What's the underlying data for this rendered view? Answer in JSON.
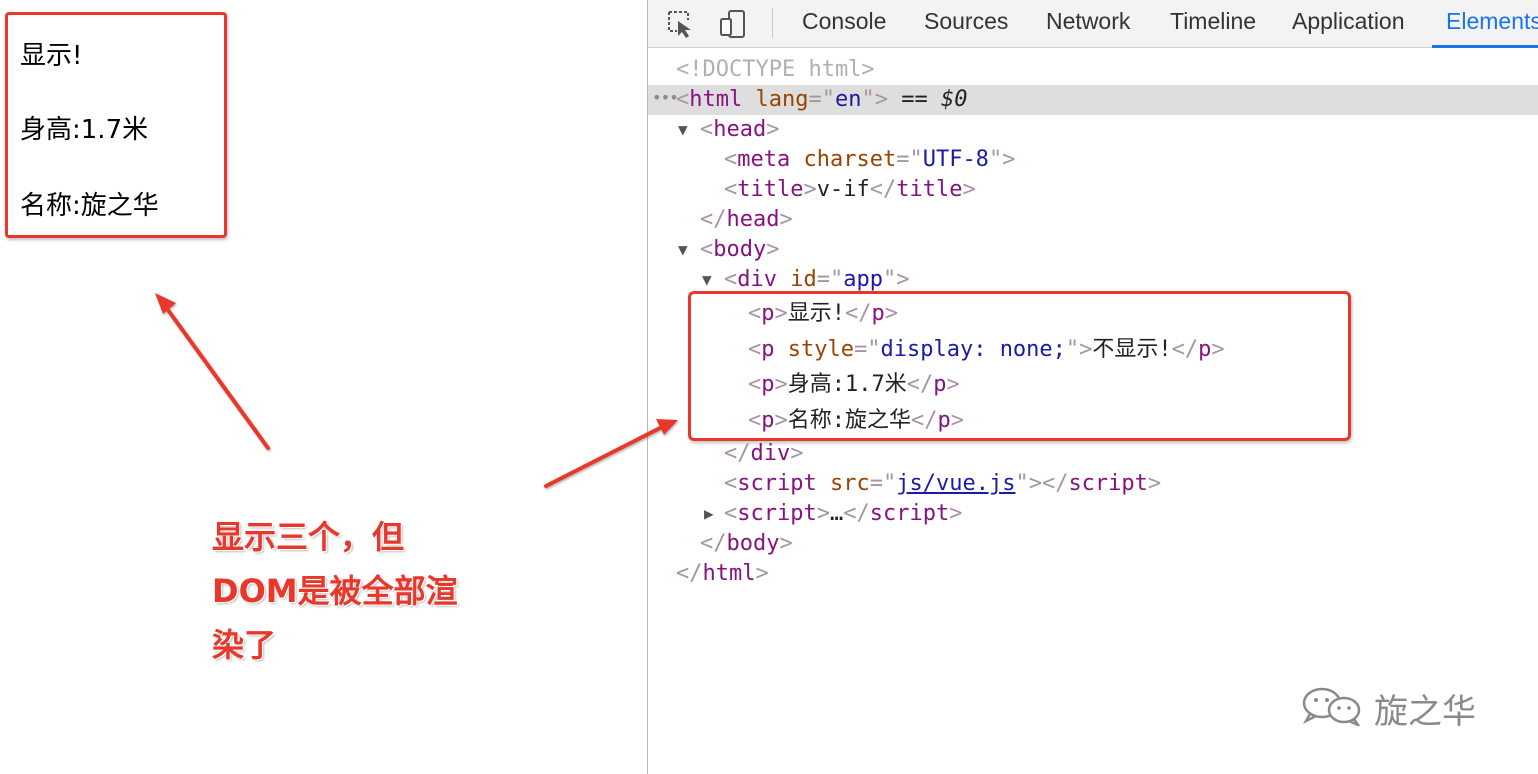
{
  "rendered_page": {
    "lines": [
      "显示!",
      "身高:1.7米",
      "名称:旋之华"
    ]
  },
  "annotation": {
    "lines": [
      "显示三个，但",
      "DOM是被全部渲",
      "染了"
    ]
  },
  "devtools": {
    "icons": [
      "inspect-element-icon",
      "device-toolbar-icon"
    ],
    "tabs": [
      "Console",
      "Sources",
      "Network",
      "Timeline",
      "Application",
      "Elements"
    ],
    "active_tab": "Elements",
    "tree": {
      "doctype": "<!DOCTYPE html>",
      "html_tag": "html",
      "html_attr": "lang",
      "html_attr_val": "en",
      "selected_ref": "== $0",
      "head": "head",
      "meta": "meta",
      "meta_attr": "charset",
      "meta_val": "UTF-8",
      "title": "title",
      "title_text": "v-if",
      "body": "body",
      "div": "div",
      "div_attr": "id",
      "div_val": "app",
      "p_tag": "p",
      "p1_text": "显示!",
      "p2_attr": "style",
      "p2_val": "display: none;",
      "p2_text": "不显示!",
      "p3_text": "身高:1.7米",
      "p4_text": "名称:旋之华",
      "script": "script",
      "script_attr": "src",
      "script_val": "js/vue.js",
      "collapsed": "…"
    }
  },
  "watermark": {
    "text": "旋之华",
    "icon": "wechat-icon"
  },
  "colors": {
    "annotation_red": "#e8372b",
    "tag": "#881280",
    "attr_name": "#994500",
    "attr_value": "#1a1aa6",
    "active_tab": "#1a73e8"
  }
}
